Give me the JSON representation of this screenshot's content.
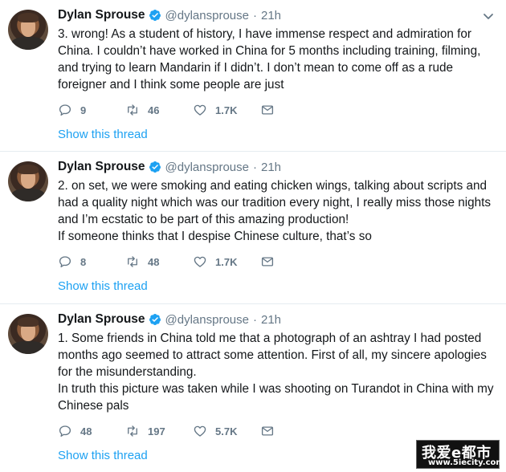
{
  "tweets": [
    {
      "name": "Dylan Sprouse",
      "handle": "@dylansprouse",
      "separator": "·",
      "time": "21h",
      "lines": [
        "3. wrong! As a student of history, I have immense respect and admiration for",
        "China. I couldn’t have worked in China for 5 months including training, filming,",
        "and trying to learn Mandarin if I didn’t. I don’t mean to come off as a rude",
        "foreigner and I think some people are just"
      ],
      "replies": "9",
      "retweets": "46",
      "likes": "1.7K",
      "show_thread": "Show this thread"
    },
    {
      "name": "Dylan Sprouse",
      "handle": "@dylansprouse",
      "separator": "·",
      "time": "21h",
      "lines": [
        "2. on set, we were smoking and eating chicken wings, talking about scripts and",
        "had a quality night which was our tradition every night, I really miss those nights",
        "and I’m ecstatic to be part of this amazing production!",
        "If someone thinks that I despise Chinese culture, that’s so"
      ],
      "replies": "8",
      "retweets": "48",
      "likes": "1.7K",
      "show_thread": "Show this thread"
    },
    {
      "name": "Dylan Sprouse",
      "handle": "@dylansprouse",
      "separator": "·",
      "time": "21h",
      "lines": [
        "1. Some friends in China told me that a photograph of an ashtray I had posted",
        "months ago seemed to attract some attention. First of all, my sincere apologies",
        "for the misunderstanding.",
        "In truth this picture was taken while I was shooting on Turandot in China with my",
        "Chinese pals"
      ],
      "replies": "48",
      "retweets": "197",
      "likes": "5.7K",
      "show_thread": "Show this thread"
    }
  ],
  "watermark": {
    "top": "我爱e都市",
    "bottom": "www.5iecity.com"
  },
  "colors": {
    "link": "#1da1f2",
    "verified": "#1da1f2",
    "muted": "#657786",
    "separator": "#e6ecf0"
  }
}
